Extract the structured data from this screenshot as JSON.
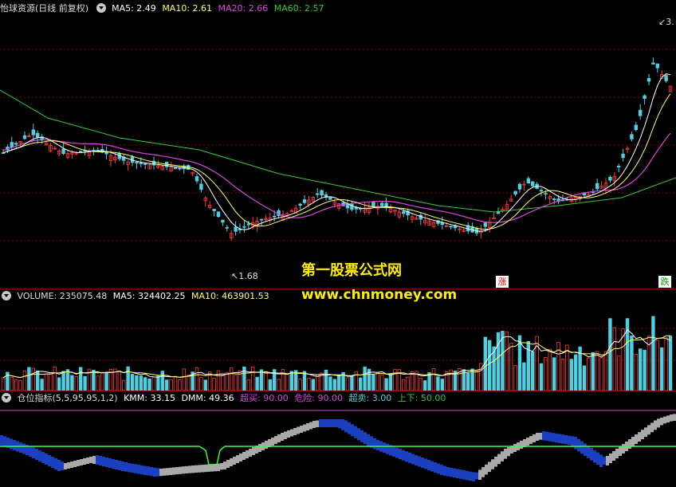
{
  "main": {
    "title": "怡球资源(日线 前复权)",
    "ma5": "MA5: 2.49",
    "ma10": "MA10: 2.61",
    "ma20": "MA20: 2.66",
    "ma60": "MA60: 2.57",
    "low_label": "1.68",
    "high_label": "3.",
    "zhang": "涨",
    "die": "跌"
  },
  "volume": {
    "label": "VOLUME: 235075.48",
    "ma5": "MA5: 324402.25",
    "ma10": "MA10: 463901.53"
  },
  "indicator": {
    "name": "仓位指标(5,5,95,95,1,2)",
    "kmm": "KMM: 33.15",
    "dmm": "DMM: 49.36",
    "chaomai": "超买: 90.00",
    "weixian": "危险: 90.00",
    "chaomai2": "超卖: 3.00",
    "shangxia": "上下: 50.00"
  },
  "watermark": {
    "line1": "第一股票公式网",
    "line2": "www.chnmoney.com"
  },
  "colors": {
    "up": "#ff3b3b",
    "down": "#4dd0e1",
    "ma5": "#ffffff",
    "ma10": "#ffff66",
    "ma20": "#dd44dd",
    "ma60": "#33cc33",
    "grid": "#8b0000",
    "blue_band": "#1a3fbf",
    "gray_band": "#a9a9a9",
    "watermark": "#ffee00"
  }
}
